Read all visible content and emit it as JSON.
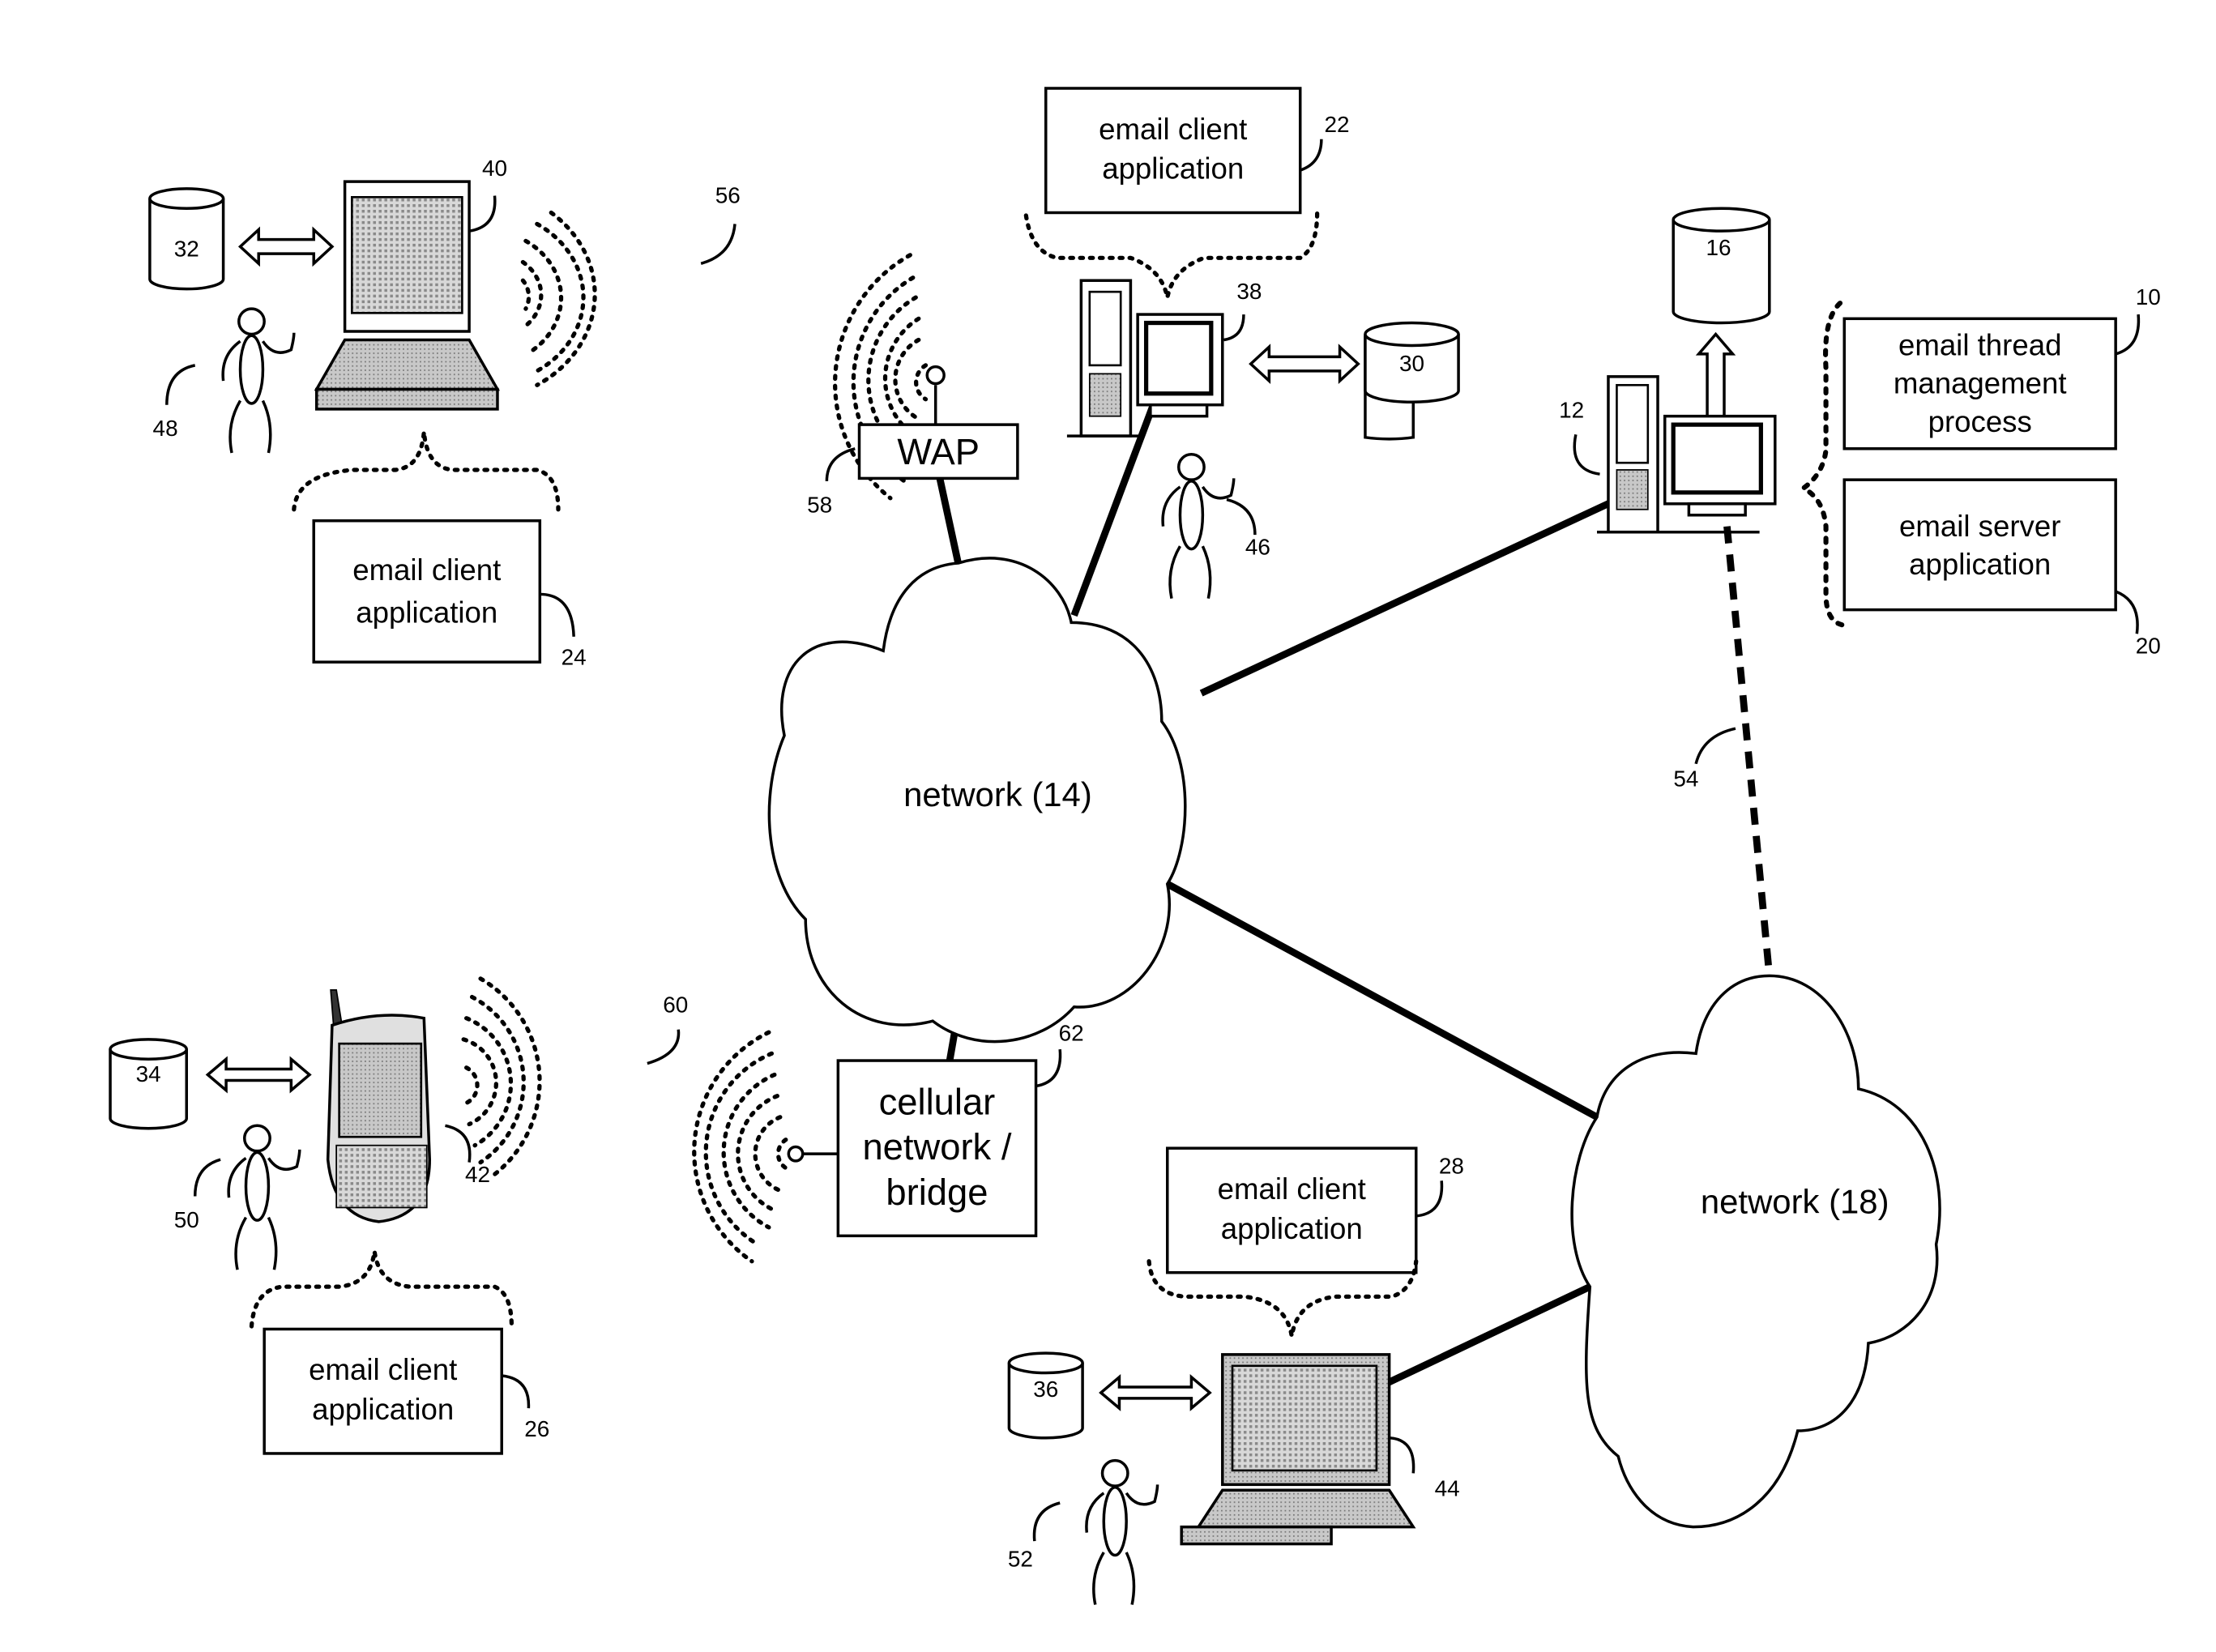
{
  "figure": {
    "networks": [
      {
        "id": "network-14",
        "label": "network (14)"
      },
      {
        "id": "network-18",
        "label": "network (18)"
      }
    ],
    "boxes": {
      "email_client_22": {
        "lines": [
          "email client",
          "application"
        ],
        "ref": "22"
      },
      "email_client_24": {
        "lines": [
          "email client",
          "application"
        ],
        "ref": "24"
      },
      "email_client_26": {
        "lines": [
          "email client",
          "application"
        ],
        "ref": "26"
      },
      "email_client_28": {
        "lines": [
          "email client",
          "application"
        ],
        "ref": "28"
      },
      "thread_mgmt_10": {
        "lines": [
          "email thread",
          "management",
          "process"
        ],
        "ref": "10"
      },
      "email_server_20": {
        "lines": [
          "email server",
          "application"
        ],
        "ref": "20"
      },
      "wap_58": {
        "lines": [
          "WAP"
        ],
        "ref": "58"
      },
      "cellular_62": {
        "lines": [
          "cellular",
          "network /",
          "bridge"
        ],
        "ref": "62"
      }
    },
    "databases": {
      "db_16": "16",
      "db_30": "30",
      "db_32": "32",
      "db_34": "34",
      "db_36": "36"
    },
    "devices": {
      "server_12": "12",
      "desktop_38": "38",
      "laptop_40": "40",
      "phone_42": "42",
      "laptop_44": "44"
    },
    "users": {
      "user_46": "46",
      "user_48": "48",
      "user_50": "50",
      "user_52": "52"
    },
    "links": {
      "link_54": "54",
      "wireless_56": "56",
      "wireless_60": "60"
    }
  }
}
